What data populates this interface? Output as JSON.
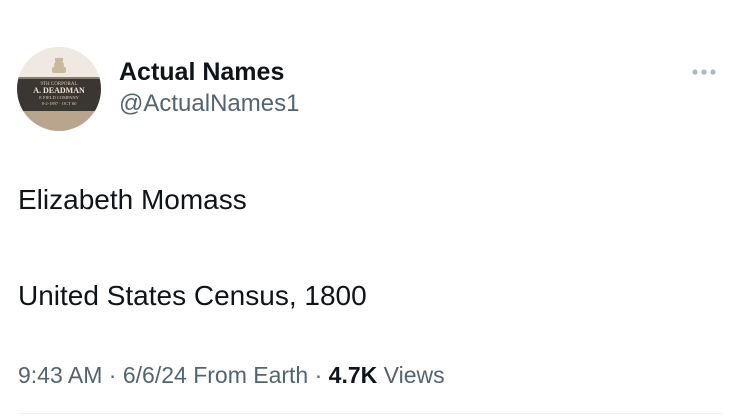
{
  "author": {
    "display_name": "Actual Names",
    "handle": "@ActualNames1",
    "avatar": {
      "plaque_line1": "9TH CORPORAL",
      "plaque_name": "A. DEADMAN",
      "plaque_line3": "E FIELD COMPANY",
      "plaque_line4": "8-2-1897 · OCT 60"
    }
  },
  "more_icon": "more-horizontal-icon",
  "tweet": {
    "line1": "Elizabeth Momass",
    "line2": "United States Census, 1800"
  },
  "meta": {
    "time": "9:43 AM",
    "sep1": " · ",
    "date": "6/6/24",
    "source": "From Earth",
    "sep2": " · ",
    "views_count": "4.7K",
    "views_label": "Views"
  },
  "colors": {
    "text_primary": "#0f1419",
    "text_secondary": "#536471",
    "icon_grey": "#aab8c2",
    "divider": "#eff3f4"
  }
}
